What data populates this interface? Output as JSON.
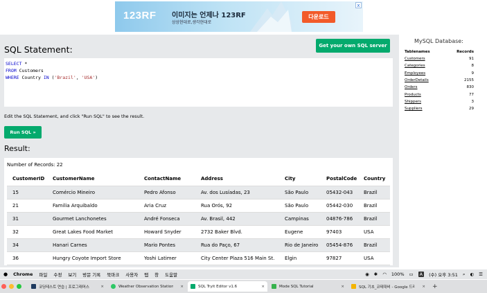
{
  "ad": {
    "logo": "123RF",
    "title": "이미지는 언제나 123RF",
    "subtitle": "상상현대로,생각현대로",
    "button": "다운로드",
    "close": "x"
  },
  "editor": {
    "heading": "SQL Statement:",
    "server_button": "Get your own SQL server",
    "code": {
      "line1_kw": "SELECT",
      "line1_rest": " *",
      "line2_kw": "FROM",
      "line2_rest": " Customers",
      "line3_kw1": "WHERE",
      "line3_mid": " Country ",
      "line3_kw2": "IN",
      "line3_p1": " (",
      "line3_s1": "'Brazil'",
      "line3_p2": ", ",
      "line3_s2": "'USA'",
      "line3_p3": ")"
    },
    "instructions": "Edit the SQL Statement, and click \"Run SQL\" to see the result.",
    "run_button": "Run SQL »"
  },
  "result": {
    "heading": "Result:",
    "record_count": "Number of Records: 22",
    "columns": [
      "CustomerID",
      "CustomerName",
      "ContactName",
      "Address",
      "City",
      "PostalCode",
      "Country"
    ],
    "rows": [
      [
        "15",
        "Comércio Mineiro",
        "Pedro Afonso",
        "Av. dos Lusíadas, 23",
        "São Paulo",
        "05432-043",
        "Brazil"
      ],
      [
        "21",
        "Familia Arquibaldo",
        "Aria Cruz",
        "Rua Orós, 92",
        "São Paulo",
        "05442-030",
        "Brazil"
      ],
      [
        "31",
        "Gourmet Lanchonetes",
        "André Fonseca",
        "Av. Brasil, 442",
        "Campinas",
        "04876-786",
        "Brazil"
      ],
      [
        "32",
        "Great Lakes Food Market",
        "Howard Snyder",
        "2732 Baker Blvd.",
        "Eugene",
        "97403",
        "USA"
      ],
      [
        "34",
        "Hanari Carnes",
        "Mario Pontes",
        "Rua do Paço, 67",
        "Rio de Janeiro",
        "05454-876",
        "Brazil"
      ],
      [
        "36",
        "Hungry Coyote Import Store",
        "Yoshi Latimer",
        "City Center Plaza 516 Main St.",
        "Elgin",
        "97827",
        "USA"
      ]
    ]
  },
  "database": {
    "title": "MySQL Database:",
    "col_name": "Tablenames",
    "col_records": "Records",
    "tables": [
      {
        "name": "Customers",
        "records": "91"
      },
      {
        "name": "Categories",
        "records": "8"
      },
      {
        "name": "Employees",
        "records": "9"
      },
      {
        "name": "OrderDetails",
        "records": "2155"
      },
      {
        "name": "Orders",
        "records": "830"
      },
      {
        "name": "Products",
        "records": "77"
      },
      {
        "name": "Shippers",
        "records": "3"
      },
      {
        "name": "Suppliers",
        "records": "29"
      }
    ]
  },
  "menubar": {
    "app": "Chrome",
    "items": [
      "파일",
      "수정",
      "보기",
      "방문 기록",
      "북마크",
      "사용자",
      "탭",
      "창",
      "도움말"
    ],
    "battery": "100%",
    "input_source": "A",
    "clock": "(수) 오후 3:51"
  },
  "tabs": [
    {
      "label": "코딩테스트 연습 | 프로그래머스",
      "favicon_color": "#1e3a5f",
      "active": false
    },
    {
      "label": "Weather Observation Station",
      "favicon_color": "#2ec866",
      "active": false
    },
    {
      "label": "SQL Tryit Editor v1.6",
      "favicon_color": "#04aa6d",
      "active": true
    },
    {
      "label": "Mode SQL Tutorial",
      "favicon_color": "#37b24d",
      "active": false
    },
    {
      "label": "SQL 기초_코테대비 - Google 드라",
      "favicon_color": "#f4b400",
      "active": false
    }
  ]
}
